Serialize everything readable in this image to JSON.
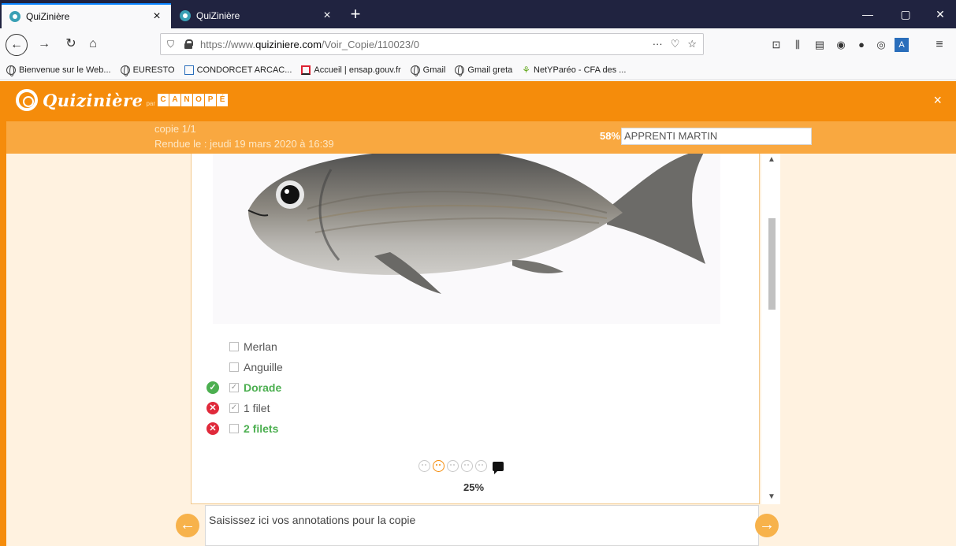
{
  "browser": {
    "tabs": [
      {
        "label": "QuiZinière",
        "close": "×"
      },
      {
        "label": "QuiZinière",
        "close": "×"
      }
    ],
    "new_tab": "+",
    "window_controls": {
      "minimize": "—",
      "maximize": "▢",
      "close": "✕"
    },
    "url_prefix": "https://www.",
    "url_domain": "quiziniere.com",
    "url_path": "/Voir_Copie/110023/0",
    "url_more": "···",
    "bookmarks": [
      "Bienvenue sur le Web...",
      "EURESTO",
      "CONDORCET ARCAC...",
      "Accueil | ensap.gouv.fr",
      "Gmail",
      "Gmail greta",
      "NetYParéo - CFA des ..."
    ]
  },
  "app": {
    "logo_text": "Quizinière",
    "logo_par": "par",
    "canope_letters": [
      "C",
      "A",
      "N",
      "O",
      "P",
      "É"
    ],
    "close": "×",
    "copy_number": "copie 1/1",
    "submitted": "Rendue le : jeudi 19 mars 2020 à 16:39",
    "score": "58%",
    "student_name": "APPRENTI MARTIN"
  },
  "question": {
    "answers": [
      {
        "label": "Merlan",
        "checked": false,
        "status": null,
        "correct": false
      },
      {
        "label": "Anguille",
        "checked": false,
        "status": null,
        "correct": false
      },
      {
        "label": "Dorade",
        "checked": true,
        "status": "ok",
        "correct": true
      },
      {
        "label": "1 filet",
        "checked": true,
        "status": "ko",
        "correct": false
      },
      {
        "label": "2 filets",
        "checked": false,
        "status": "ko",
        "correct": true
      }
    ],
    "rating_selected": 2,
    "percent": "25%"
  },
  "annotation": {
    "placeholder": "Saisissez ici vos annotations pour la copie"
  },
  "colors": {
    "accent": "#f58c0b",
    "bar": "#f9a840",
    "correct": "#4caf50",
    "wrong": "#e02a3b"
  }
}
